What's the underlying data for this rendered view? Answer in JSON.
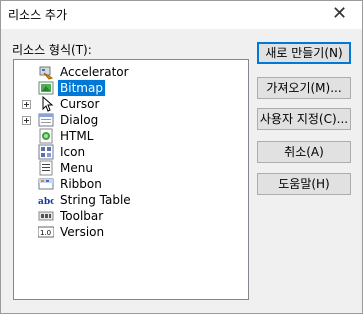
{
  "window": {
    "title": "리소스 추가",
    "close_glyph": "✕"
  },
  "label": "리소스 형식(T):",
  "tree": {
    "items": [
      {
        "label": "Accelerator",
        "icon": "accelerator-icon",
        "expandable": false,
        "selected": false
      },
      {
        "label": "Bitmap",
        "icon": "bitmap-icon",
        "expandable": false,
        "selected": true
      },
      {
        "label": "Cursor",
        "icon": "cursor-icon",
        "expandable": true,
        "selected": false
      },
      {
        "label": "Dialog",
        "icon": "dialog-icon",
        "expandable": true,
        "selected": false
      },
      {
        "label": "HTML",
        "icon": "html-icon",
        "expandable": false,
        "selected": false
      },
      {
        "label": "Icon",
        "icon": "icon-resource-icon",
        "expandable": false,
        "selected": false
      },
      {
        "label": "Menu",
        "icon": "menu-icon",
        "expandable": false,
        "selected": false
      },
      {
        "label": "Ribbon",
        "icon": "ribbon-icon",
        "expandable": false,
        "selected": false
      },
      {
        "label": "String Table",
        "icon": "string-table-icon",
        "expandable": false,
        "selected": false
      },
      {
        "label": "Toolbar",
        "icon": "toolbar-icon",
        "expandable": false,
        "selected": false
      },
      {
        "label": "Version",
        "icon": "version-icon",
        "expandable": false,
        "selected": false
      }
    ]
  },
  "buttons": {
    "new": "새로 만들기(N)",
    "import": "가져오기(M)...",
    "custom": "사용자 지정(C)...",
    "cancel": "취소(A)",
    "help": "도움말(H)"
  },
  "colors": {
    "selection": "#0078d7",
    "dialog_bg": "#f0f0f0"
  }
}
